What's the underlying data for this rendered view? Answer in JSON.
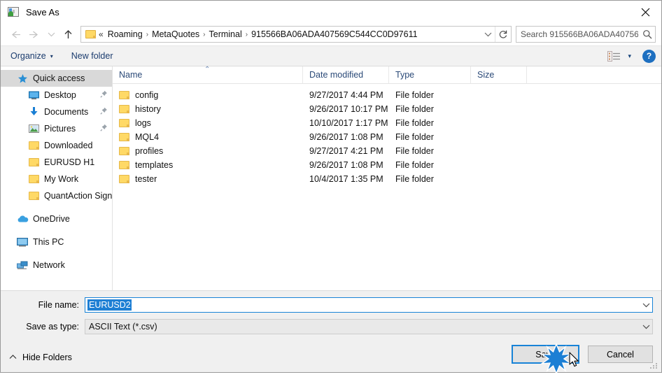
{
  "window": {
    "title": "Save As",
    "icon": "save-as-icon",
    "close_label": "✕"
  },
  "nav": {
    "back": "←",
    "forward": "→",
    "recent": "⌄",
    "up": "↑",
    "refresh": "↻",
    "dropdown": "⌄"
  },
  "address": {
    "prefix": "«",
    "crumbs": [
      "Roaming",
      "MetaQuotes",
      "Terminal",
      "915566BA06ADA407569C544CC0D97611"
    ],
    "separator": "›"
  },
  "search": {
    "placeholder": "Search 915566BA06ADA40756...",
    "icon": "search-icon",
    "value": ""
  },
  "toolbar": {
    "organize_label": "Organize",
    "organize_caret": "▾",
    "new_folder_label": "New folder",
    "view_icon": "view-list-icon",
    "view_caret": "▾",
    "help_label": "?"
  },
  "sidebar": {
    "items": [
      {
        "label": "Quick access",
        "icon": "star-icon",
        "level": 0,
        "selected": true,
        "pinned": false
      },
      {
        "label": "Desktop",
        "icon": "desktop-icon",
        "level": 1,
        "selected": false,
        "pinned": true
      },
      {
        "label": "Documents",
        "icon": "documents-icon",
        "level": 1,
        "selected": false,
        "pinned": true
      },
      {
        "label": "Pictures",
        "icon": "pictures-icon",
        "level": 1,
        "selected": false,
        "pinned": true
      },
      {
        "label": "Downloaded",
        "icon": "folder-icon",
        "level": 1,
        "selected": false,
        "pinned": false
      },
      {
        "label": "EURUSD H1",
        "icon": "folder-icon",
        "level": 1,
        "selected": false,
        "pinned": false
      },
      {
        "label": "My Work",
        "icon": "folder-icon",
        "level": 1,
        "selected": false,
        "pinned": false
      },
      {
        "label": "QuantAction Signal",
        "icon": "folder-icon",
        "level": 1,
        "selected": false,
        "pinned": false
      },
      {
        "label": "OneDrive",
        "icon": "onedrive-icon",
        "level": 0,
        "selected": false,
        "pinned": false,
        "gap_before": true
      },
      {
        "label": "This PC",
        "icon": "this-pc-icon",
        "level": 0,
        "selected": false,
        "pinned": false,
        "gap_before": true
      },
      {
        "label": "Network",
        "icon": "network-icon",
        "level": 0,
        "selected": false,
        "pinned": false,
        "gap_before": true
      }
    ]
  },
  "filelist": {
    "columns": [
      "Name",
      "Date modified",
      "Type",
      "Size"
    ],
    "sort_indicator": "⌃",
    "rows": [
      {
        "name": "config",
        "date": "9/27/2017 4:44 PM",
        "type": "File folder",
        "size": ""
      },
      {
        "name": "history",
        "date": "9/26/2017 10:17 PM",
        "type": "File folder",
        "size": ""
      },
      {
        "name": "logs",
        "date": "10/10/2017 1:17 PM",
        "type": "File folder",
        "size": ""
      },
      {
        "name": "MQL4",
        "date": "9/26/2017 1:08 PM",
        "type": "File folder",
        "size": ""
      },
      {
        "name": "profiles",
        "date": "9/27/2017 4:21 PM",
        "type": "File folder",
        "size": ""
      },
      {
        "name": "templates",
        "date": "9/26/2017 1:08 PM",
        "type": "File folder",
        "size": ""
      },
      {
        "name": "tester",
        "date": "10/4/2017 1:35 PM",
        "type": "File folder",
        "size": ""
      }
    ]
  },
  "form": {
    "filename_label": "File name:",
    "filename_value": "EURUSD2",
    "filetype_label": "Save as type:",
    "filetype_value": "ASCII Text (*.csv)",
    "combo_caret": "⌄"
  },
  "buttons": {
    "save": "Save",
    "cancel": "Cancel",
    "hide_folders": "Hide Folders",
    "hide_folders_caret": "⌃"
  },
  "colors": {
    "accent": "#1883d7",
    "selection": "#1e7fd4",
    "folder": "#ffd966",
    "link": "#1b3c6e",
    "help": "#1d6fc0"
  }
}
